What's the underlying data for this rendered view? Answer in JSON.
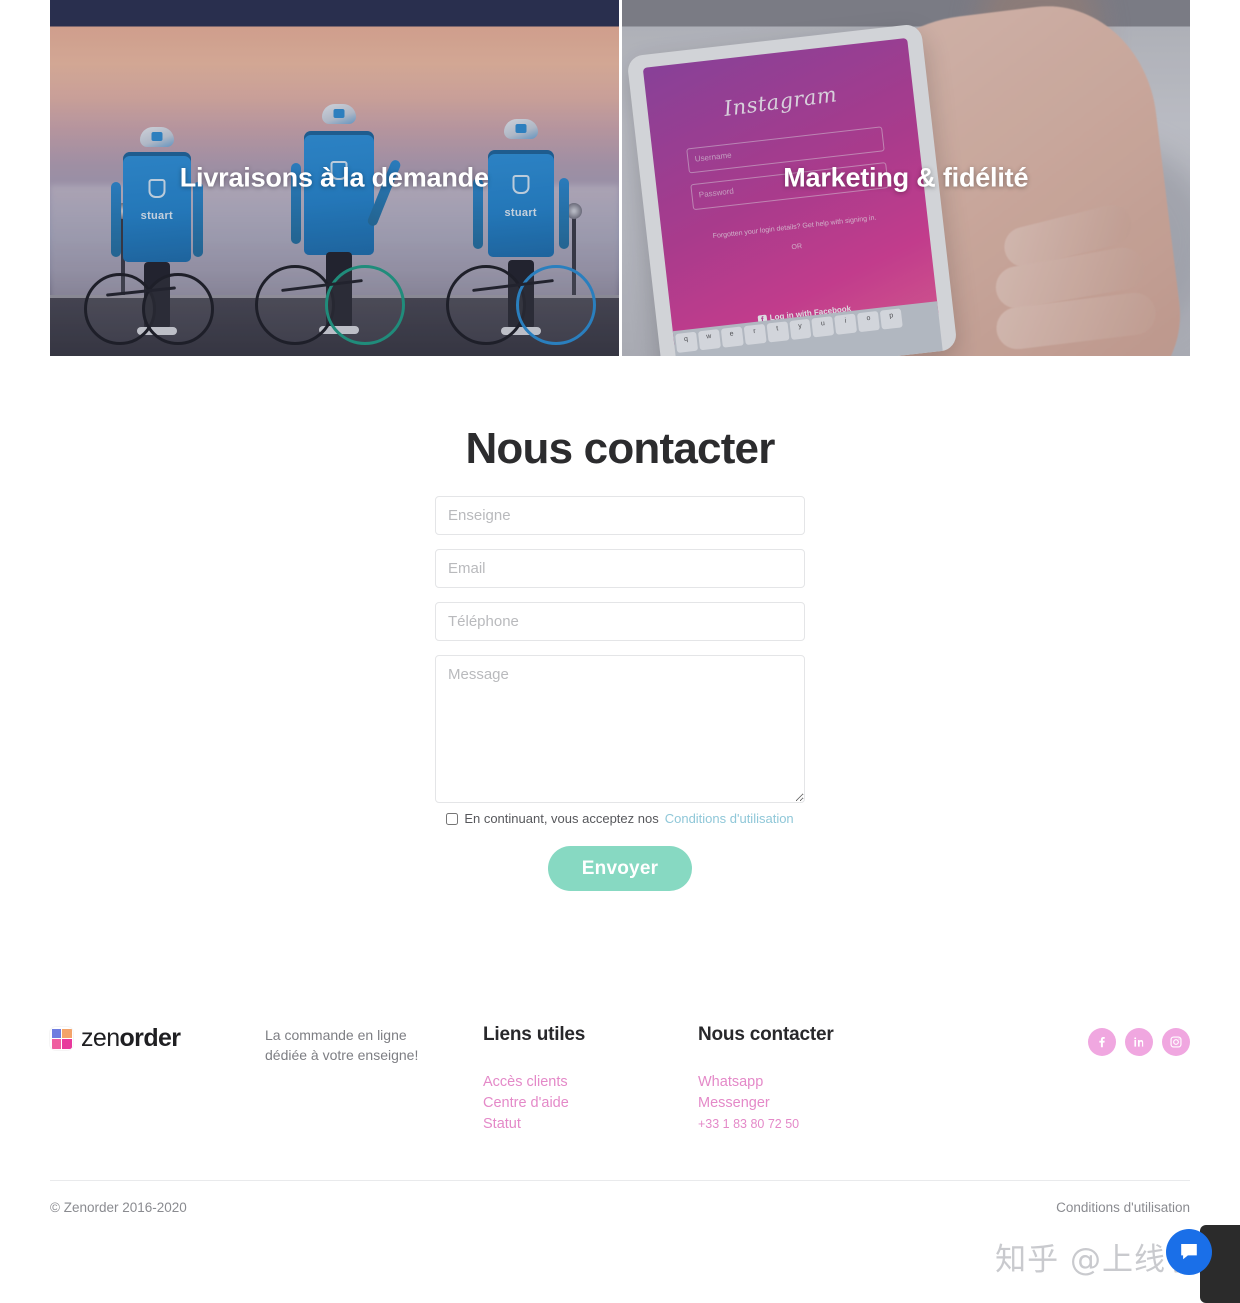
{
  "hero": {
    "cards": [
      {
        "title": "Livraisons à la demande",
        "image_alt": "three-cyclists-at-dusk",
        "brand_on_bag": "stuart"
      },
      {
        "title": "Marketing & fidélité",
        "image_alt": "hand-holding-phone-instagram-login",
        "phone_app": "Instagram"
      }
    ]
  },
  "phone_screen": {
    "app_name": "Instagram",
    "username_placeholder": "Username",
    "password_placeholder": "Password",
    "forgot_text": "Forgotten your login details? Get help with signing in.",
    "or_text": "OR",
    "facebook_login": "Log in with Facebook",
    "keys": [
      "q",
      "w",
      "e",
      "r",
      "t",
      "y",
      "u",
      "i",
      "o",
      "p"
    ]
  },
  "contact": {
    "title": "Nous contacter",
    "fields": [
      {
        "name": "enseigne",
        "placeholder": "Enseigne",
        "value": ""
      },
      {
        "name": "email",
        "placeholder": "Email",
        "value": ""
      },
      {
        "name": "telephone",
        "placeholder": "Téléphone",
        "value": ""
      }
    ],
    "message": {
      "placeholder": "Message",
      "value": ""
    },
    "consent": {
      "checked": false,
      "text": "En continuant, vous acceptez nos",
      "link_label": "Conditions d'utilisation"
    },
    "submit_label": "Envoyer"
  },
  "footer": {
    "logo": {
      "zen": "zen",
      "order": "order"
    },
    "tagline": "La commande en ligne dédiée à votre enseigne!",
    "columns": [
      {
        "heading": "Liens utiles",
        "links": [
          "Accès clients",
          "Centre d'aide",
          "Statut"
        ]
      },
      {
        "heading": "Nous contacter",
        "links": [
          "Whatsapp",
          "Messenger"
        ],
        "phone": "+33 1 83 80 72 50"
      }
    ],
    "socials": [
      {
        "name": "facebook-icon",
        "label": "Facebook"
      },
      {
        "name": "linkedin-icon",
        "label": "LinkedIn"
      },
      {
        "name": "instagram-icon",
        "label": "Instagram"
      }
    ],
    "copyright": "© Zenorder 2016-2020",
    "terms": "Conditions d'utilisation"
  },
  "watermark": {
    "text": "知乎 @上线了"
  },
  "colors": {
    "accent_mint": "#87d9c2",
    "accent_pink": "#e489c8",
    "social_pink": "#f0a7e0",
    "consent_link": "#8fc7d8",
    "text_dark": "#28282b",
    "text_muted": "#8a8b90"
  }
}
